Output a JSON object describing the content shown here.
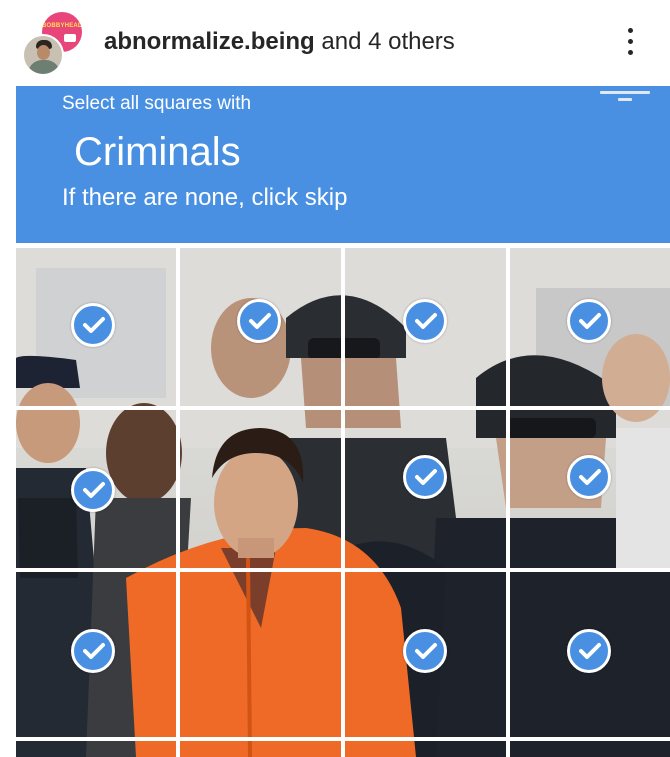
{
  "post": {
    "username": "abnormalize.being",
    "collaborators_text": " and 4 others",
    "avatar_badge_text": "BOBBYHEAD",
    "more_icon": "more-vertical-icon"
  },
  "captcha": {
    "instruction": "Select all squares with",
    "target": "Criminals",
    "hint": "If there are none, click skip",
    "banner_color": "#4a90e2",
    "check_color": "#4a90e2",
    "check_icon": "checkmark-icon",
    "grid": {
      "rows": 3,
      "cols": 4,
      "selected": [
        [
          true,
          true,
          true,
          true
        ],
        [
          true,
          false,
          true,
          true
        ],
        [
          true,
          false,
          true,
          true
        ]
      ]
    }
  }
}
